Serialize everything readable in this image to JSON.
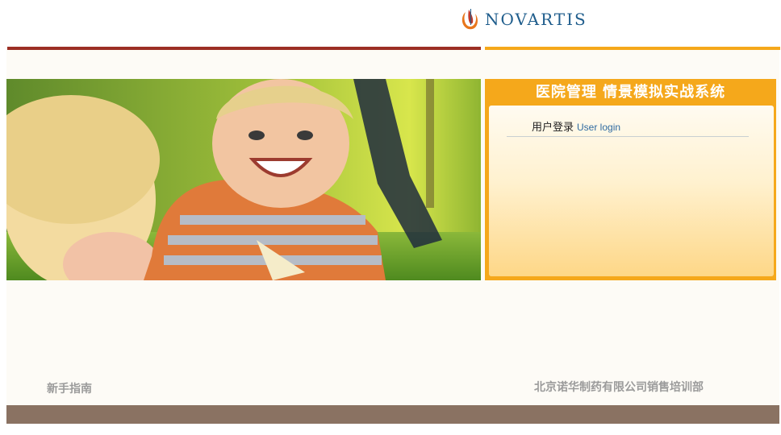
{
  "brand": {
    "logo_text": "NOVARTIS"
  },
  "colors": {
    "left_rule": "#9c2f24",
    "right_rule": "#f5a81b",
    "panel": "#f5a81b",
    "footer": "#8a7262"
  },
  "login": {
    "title": "医院管理 情景模拟实战系统",
    "label_cn": "用户登录",
    "label_en": "User login"
  },
  "footer": {
    "guide_link": "新手指南",
    "company": "北京诺华制药有限公司销售培训部"
  }
}
